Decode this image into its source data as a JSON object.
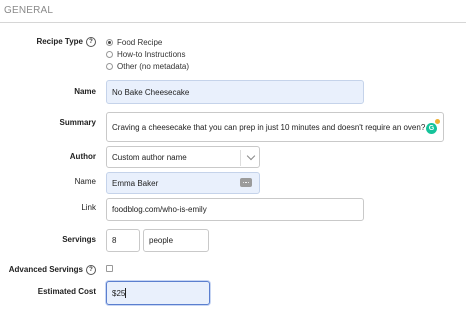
{
  "section": {
    "title": "GENERAL"
  },
  "recipe_type": {
    "label": "Recipe Type",
    "help_icon": "?",
    "options": [
      {
        "label": "Food Recipe",
        "selected": true
      },
      {
        "label": "How-to Instructions",
        "selected": false
      },
      {
        "label": "Other (no metadata)",
        "selected": false
      }
    ]
  },
  "name": {
    "label": "Name",
    "value": "No Bake Cheesecake"
  },
  "summary": {
    "label": "Summary",
    "value": "Craving a cheesecake that you can prep in just 10 minutes and doesn't require an oven?",
    "grammarly_letter": "G"
  },
  "author": {
    "label": "Author",
    "select_value": "Custom author name",
    "name_label": "Name",
    "name_value": "Emma Baker",
    "link_label": "Link",
    "link_value": "foodblog.com/who-is-emily"
  },
  "servings": {
    "label": "Servings",
    "amount": "8",
    "unit": "people"
  },
  "advanced_servings": {
    "label": "Advanced Servings",
    "help_icon": "?",
    "checked": false
  },
  "estimated_cost": {
    "label": "Estimated Cost",
    "value": "$25"
  },
  "colors": {
    "filled_field": "#e9f0fc",
    "focus_border": "#5b7fcf",
    "grammarly": "#15c39a"
  }
}
